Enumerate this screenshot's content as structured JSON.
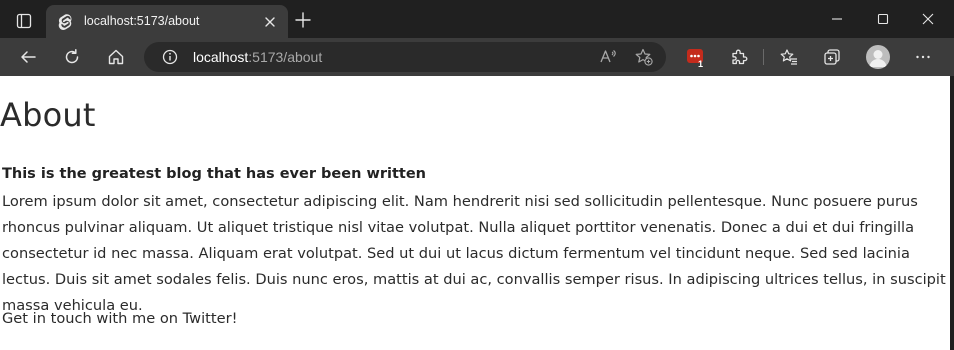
{
  "browser": {
    "tab": {
      "title": "localhost:5173/about",
      "favicon": "svelte-logo-icon"
    },
    "address_bar": {
      "host": "localhost",
      "rest": ":5173/about"
    },
    "extension_badge_count": "1",
    "colors": {
      "titlebar": "#202020",
      "toolbar": "#3c3c3c",
      "extension_badge": "#c42b1c"
    }
  },
  "page": {
    "heading": "About",
    "subtitle": "This is the greatest blog that has ever been written",
    "body": "Lorem ipsum dolor sit amet, consectetur adipiscing elit. Nam hendrerit nisi sed sollicitudin pellentesque. Nunc posuere purus rhoncus pulvinar aliquam. Ut aliquet tristique nisl vitae volutpat. Nulla aliquet porttitor venenatis. Donec a dui et dui fringilla consectetur id nec massa. Aliquam erat volutpat. Sed ut dui ut lacus dictum fermentum vel tincidunt neque. Sed sed lacinia lectus. Duis sit amet sodales felis. Duis nunc eros, mattis at dui ac, convallis semper risus. In adipiscing ultrices tellus, in suscipit massa vehicula eu.",
    "contact": "Get in touch with me on Twitter!"
  }
}
